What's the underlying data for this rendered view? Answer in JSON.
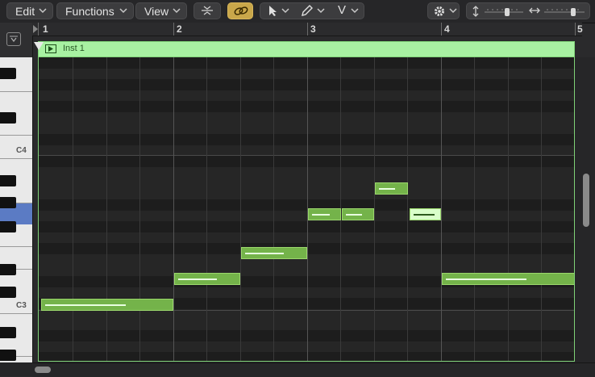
{
  "toolbar": {
    "edit_label": "Edit",
    "functions_label": "Functions",
    "view_label": "View",
    "icons": [
      "collapse-icon",
      "link-icon",
      "pointer-tool-icon",
      "pencil-tool-icon",
      "velocity-tool-icon",
      "gear-icon",
      "vertical-zoom-icon",
      "horizontal-zoom-icon"
    ],
    "velocity_tool_label": "V",
    "link_active_color": "#c9a74a"
  },
  "ruler": {
    "bars": [
      "1",
      "2",
      "3",
      "4",
      "5"
    ]
  },
  "keyboard": {
    "labels": [
      "C4",
      "C3"
    ],
    "highlight_color": "#5b7bc4"
  },
  "region": {
    "name": "Inst 1",
    "color": "#a8f1a2"
  },
  "notes": {
    "color": "#74b34a",
    "selected_color": "#d9ffca"
  }
}
